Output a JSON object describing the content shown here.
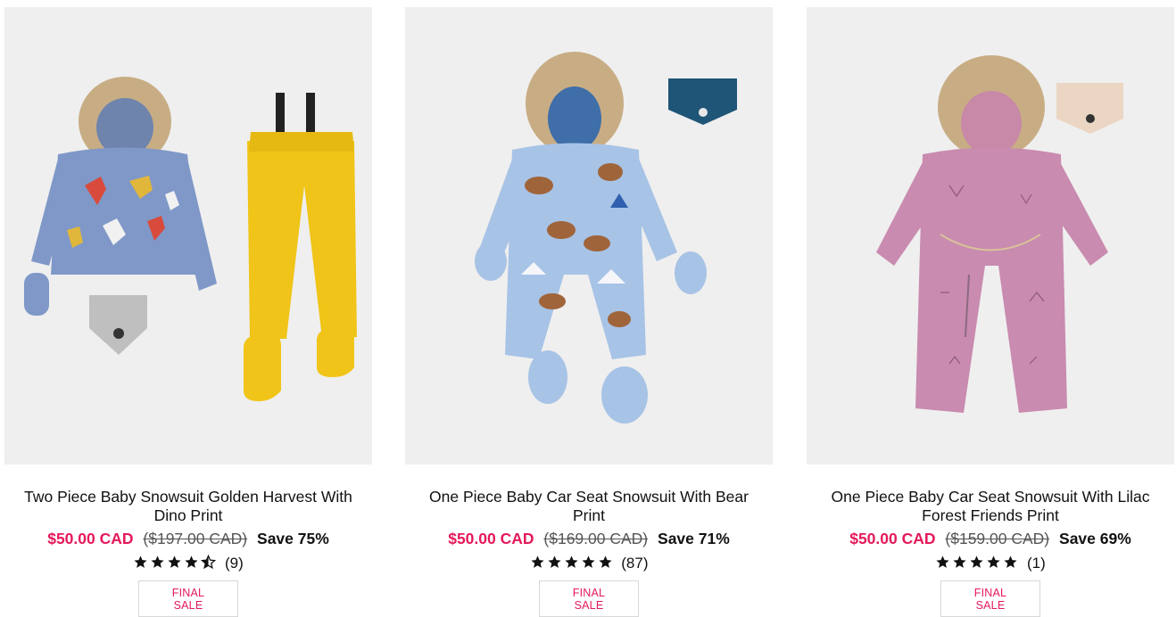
{
  "products": [
    {
      "title": "Two Piece Baby Snowsuit Golden Harvest With Dino Print",
      "sale_price": "$50.00 CAD",
      "compare_price": "($197.00 CAD)",
      "save": "Save 75%",
      "rating": 4.5,
      "review_count": "(9)",
      "badge": "FINAL SALE"
    },
    {
      "title": "One Piece Baby Car Seat Snowsuit With Bear Print",
      "sale_price": "$50.00 CAD",
      "compare_price": "($169.00 CAD)",
      "save": "Save 71%",
      "rating": 5,
      "review_count": "(87)",
      "badge": "FINAL SALE"
    },
    {
      "title": "One Piece Baby Car Seat Snowsuit With Lilac Forest Friends Print",
      "sale_price": "$50.00 CAD",
      "compare_price": "($159.00 CAD)",
      "save": "Save 69%",
      "rating": 5,
      "review_count": "(1)",
      "badge": "FINAL SALE"
    }
  ],
  "colors": {
    "sale": "#e5195a",
    "image_bg": "#efefef",
    "badge_border": "#d8d8d8"
  }
}
